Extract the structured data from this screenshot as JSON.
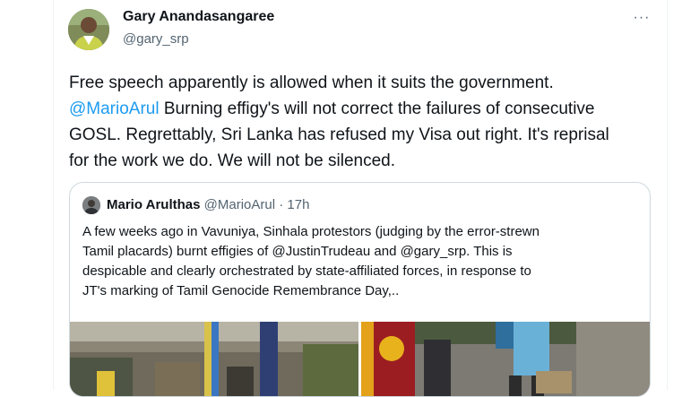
{
  "tweet": {
    "author_name": "Gary Anandasangaree",
    "author_handle": "@gary_srp",
    "more_label": "···",
    "line1": "Free speech apparently is allowed when it suits the government.",
    "line2_mention": "@MarioArul",
    "line2_rest": " Burning effigy's will not correct the failures of consecutive",
    "line3": "GOSL.  Regrettably, Sri Lanka has refused my Visa out right. It's reprisal",
    "line4": "for the work we do.  We will not be silenced."
  },
  "quote": {
    "author_name": "Mario Arulthas",
    "author_handle": "@MarioArul",
    "separator": " · ",
    "time": "17h",
    "line1": "A few weeks ago in Vavuniya, Sinhala protestors (judging by the error-strewn",
    "line2": "Tamil placards) burnt effigies of @JustinTrudeau and @gary_srp. This is",
    "line3": "despicable and clearly orchestrated by state-affiliated forces, in response to",
    "line4": "JT's marking of Tamil Genocide Remembrance Day,.."
  },
  "colors": {
    "link": "#1d9bf0",
    "secondary_text": "#536471",
    "border": "#cfd9de"
  }
}
